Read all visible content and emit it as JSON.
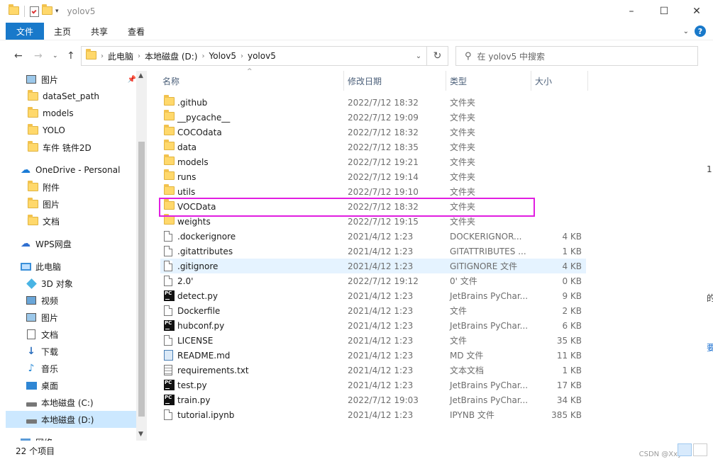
{
  "window": {
    "title": "yolov5",
    "controls": [
      "–",
      "☐",
      "✕"
    ]
  },
  "ribbon": {
    "tabs": [
      "文件",
      "主页",
      "共享",
      "查看"
    ]
  },
  "address": {
    "crumbs": [
      "此电脑",
      "本地磁盘 (D:)",
      "Yolov5",
      "yolov5"
    ],
    "search_placeholder": "在 yolov5 中搜索"
  },
  "nav": {
    "items": [
      {
        "label": "图片",
        "icon": "pictures-icon",
        "pinned": true
      },
      {
        "label": "dataSet_path",
        "icon": "folder-icon"
      },
      {
        "label": "models",
        "icon": "folder-icon"
      },
      {
        "label": "YOLO",
        "icon": "folder-icon"
      },
      {
        "label": "车件 铣件2D",
        "icon": "folder-icon"
      },
      {
        "label": "OneDrive - Personal",
        "icon": "cloud-icon"
      },
      {
        "label": "附件",
        "icon": "folder-icon"
      },
      {
        "label": "图片",
        "icon": "folder-icon"
      },
      {
        "label": "文档",
        "icon": "folder-icon"
      },
      {
        "label": "WPS网盘",
        "icon": "wps-cloud-icon"
      },
      {
        "label": "此电脑",
        "icon": "computer-icon"
      },
      {
        "label": "3D 对象",
        "icon": "3d-objects-icon"
      },
      {
        "label": "视频",
        "icon": "videos-icon"
      },
      {
        "label": "图片",
        "icon": "pictures-icon"
      },
      {
        "label": "文档",
        "icon": "documents-icon"
      },
      {
        "label": "下载",
        "icon": "download-icon"
      },
      {
        "label": "音乐",
        "icon": "music-icon"
      },
      {
        "label": "桌面",
        "icon": "desktop-icon"
      },
      {
        "label": "本地磁盘 (C:)",
        "icon": "drive-icon"
      },
      {
        "label": "本地磁盘 (D:)",
        "icon": "drive-icon",
        "selected": true
      },
      {
        "label": "网络",
        "icon": "network-icon"
      }
    ]
  },
  "columns": {
    "name": "名称",
    "date": "修改日期",
    "type": "类型",
    "size": "大小"
  },
  "files": [
    {
      "name": ".github",
      "date": "2022/7/12 18:32",
      "type": "文件夹",
      "size": "",
      "icon": "folder-icon"
    },
    {
      "name": "__pycache__",
      "date": "2022/7/12 19:09",
      "type": "文件夹",
      "size": "",
      "icon": "folder-icon"
    },
    {
      "name": "COCOdata",
      "date": "2022/7/12 18:32",
      "type": "文件夹",
      "size": "",
      "icon": "folder-icon"
    },
    {
      "name": "data",
      "date": "2022/7/12 18:35",
      "type": "文件夹",
      "size": "",
      "icon": "folder-icon"
    },
    {
      "name": "models",
      "date": "2022/7/12 19:21",
      "type": "文件夹",
      "size": "",
      "icon": "folder-icon"
    },
    {
      "name": "runs",
      "date": "2022/7/12 19:14",
      "type": "文件夹",
      "size": "",
      "icon": "folder-icon"
    },
    {
      "name": "utils",
      "date": "2022/7/12 19:10",
      "type": "文件夹",
      "size": "",
      "icon": "folder-icon"
    },
    {
      "name": "VOCData",
      "date": "2022/7/12 18:32",
      "type": "文件夹",
      "size": "",
      "icon": "folder-icon"
    },
    {
      "name": "weights",
      "date": "2022/7/12 19:15",
      "type": "文件夹",
      "size": "",
      "icon": "folder-icon"
    },
    {
      "name": ".dockerignore",
      "date": "2021/4/12 1:23",
      "type": "DOCKERIGNOR...",
      "size": "4 KB",
      "icon": "file-icon"
    },
    {
      "name": ".gitattributes",
      "date": "2021/4/12 1:23",
      "type": "GITATTRIBUTES ...",
      "size": "1 KB",
      "icon": "file-icon"
    },
    {
      "name": ".gitignore",
      "date": "2021/4/12 1:23",
      "type": "GITIGNORE 文件",
      "size": "4 KB",
      "icon": "file-icon",
      "hover": true
    },
    {
      "name": "2.0'",
      "date": "2022/7/12 19:12",
      "type": "0' 文件",
      "size": "0 KB",
      "icon": "file-icon"
    },
    {
      "name": "detect.py",
      "date": "2021/4/12 1:23",
      "type": "JetBrains PyChar...",
      "size": "9 KB",
      "icon": "pycharm-icon"
    },
    {
      "name": "Dockerfile",
      "date": "2021/4/12 1:23",
      "type": "文件",
      "size": "2 KB",
      "icon": "file-icon"
    },
    {
      "name": "hubconf.py",
      "date": "2021/4/12 1:23",
      "type": "JetBrains PyChar...",
      "size": "6 KB",
      "icon": "pycharm-icon"
    },
    {
      "name": "LICENSE",
      "date": "2021/4/12 1:23",
      "type": "文件",
      "size": "35 KB",
      "icon": "file-icon"
    },
    {
      "name": "README.md",
      "date": "2021/4/12 1:23",
      "type": "MD 文件",
      "size": "11 KB",
      "icon": "markdown-icon"
    },
    {
      "name": "requirements.txt",
      "date": "2021/4/12 1:23",
      "type": "文本文档",
      "size": "1 KB",
      "icon": "text-file-icon"
    },
    {
      "name": "test.py",
      "date": "2021/4/12 1:23",
      "type": "JetBrains PyChar...",
      "size": "17 KB",
      "icon": "pycharm-icon"
    },
    {
      "name": "train.py",
      "date": "2022/7/12 19:03",
      "type": "JetBrains PyChar...",
      "size": "34 KB",
      "icon": "pycharm-icon"
    },
    {
      "name": "tutorial.ipynb",
      "date": "2021/4/12 1:23",
      "type": "IPYNB 文件",
      "size": "385 KB",
      "icon": "file-icon"
    }
  ],
  "status": {
    "count": "22 个项目",
    "watermark": "CSDN @Xxy"
  },
  "colors": {
    "accent": "#1979ca",
    "selection": "#cce8ff",
    "hover": "#e5f3ff",
    "annotation": "#e11ee1"
  }
}
